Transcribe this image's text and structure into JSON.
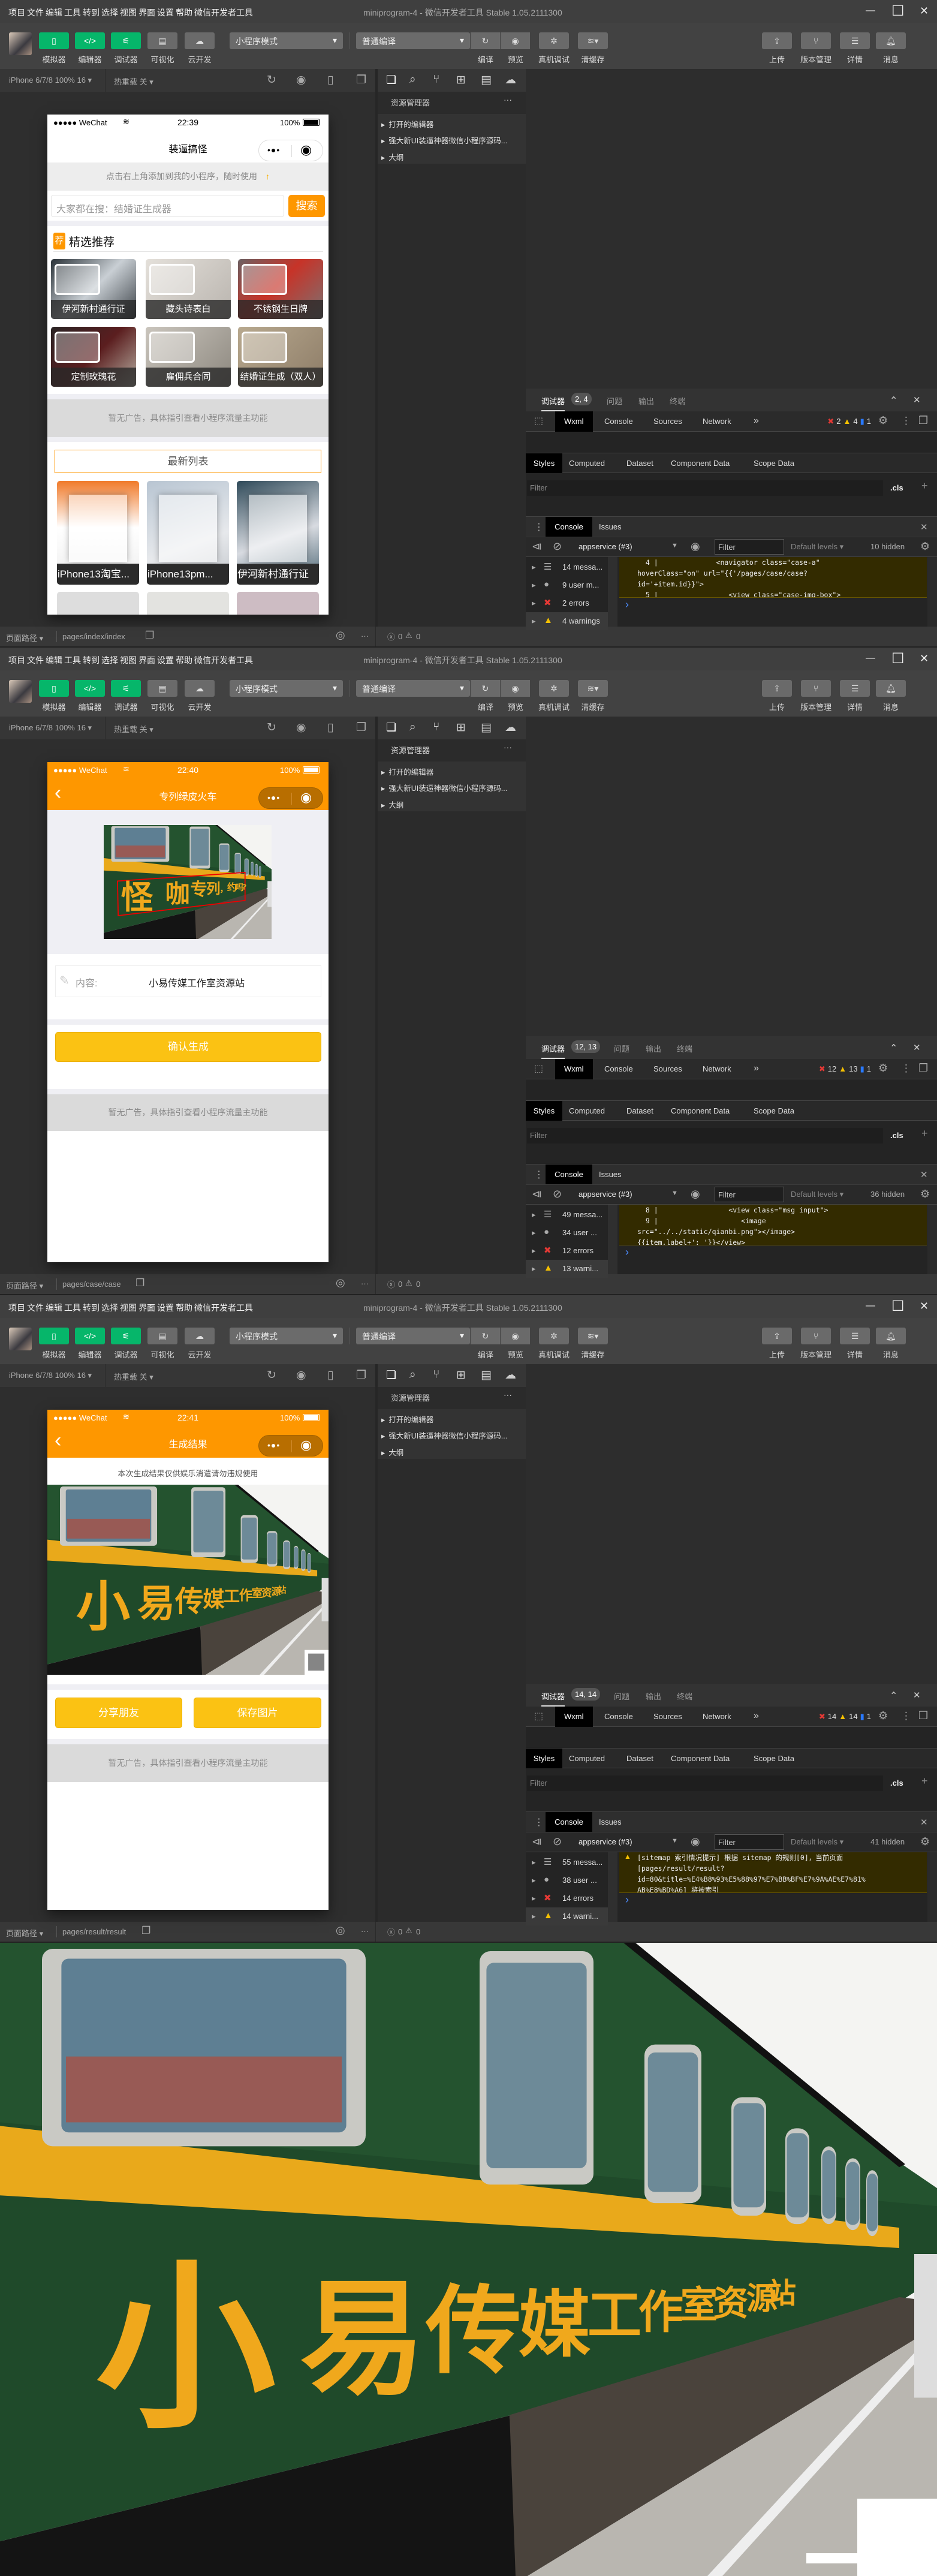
{
  "chrome": {
    "menu": [
      "项目",
      "文件",
      "编辑",
      "工具",
      "转到",
      "选择",
      "视图",
      "界面",
      "设置",
      "帮助",
      "微信开发者工具"
    ],
    "window_title": "miniprogram-4 - 微信开发者工具 Stable 1.05.2111300",
    "left_tools": [
      {
        "label": "模拟器",
        "icon": "phone-icon",
        "glyph": "▯"
      },
      {
        "label": "编辑器",
        "icon": "code-icon",
        "glyph": "</>"
      },
      {
        "label": "调试器",
        "icon": "debug-icon",
        "glyph": "⚟"
      },
      {
        "label": "可视化",
        "icon": "layout-icon",
        "glyph": "▤"
      },
      {
        "label": "云开发",
        "icon": "cloud-icon",
        "glyph": "☁"
      }
    ],
    "mode_select": "小程序模式",
    "compile_select": "普通编译",
    "mid_tools": [
      {
        "label": "编译",
        "icon": "refresh-icon",
        "glyph": "↻"
      },
      {
        "label": "预览",
        "icon": "eye-icon",
        "glyph": "◉"
      },
      {
        "label": "真机调试",
        "icon": "bug-icon",
        "glyph": "✲"
      },
      {
        "label": "清缓存",
        "icon": "layers-icon",
        "glyph": "≋▾"
      }
    ],
    "right_tools": [
      {
        "label": "上传",
        "icon": "upload-icon",
        "glyph": "⇪"
      },
      {
        "label": "版本管理",
        "icon": "branch-icon",
        "glyph": "⑂"
      },
      {
        "label": "详情",
        "icon": "details-icon",
        "glyph": "☰"
      },
      {
        "label": "消息",
        "icon": "bell-icon",
        "glyph": "🔔︎"
      }
    ],
    "device": "iPhone 6/7/8 100% 16 ▾",
    "hot_reload": "热重载 关 ▾",
    "explorer_title": "资源管理器",
    "explorer_more": "···",
    "explorer_items": [
      "打开的编辑器",
      "强大新UI装逼神器微信小程序源码...",
      "大纲"
    ],
    "debugger_tabs": [
      "调试器",
      "问题",
      "输出",
      "终端"
    ],
    "devtools_tabs": [
      "Wxml",
      "Console",
      "Sources",
      "Network"
    ],
    "styles_tabs": [
      "Styles",
      "Computed",
      "Dataset",
      "Component Data",
      "Scope Data"
    ],
    "filter_placeholder": "Filter",
    "cls": ".cls",
    "drawer_tabs": [
      "Console",
      "Issues"
    ],
    "context": "appservice (#3)",
    "levels": "Default levels ▾",
    "footer_label": "页面路径 ▾",
    "footer_errors": "0",
    "footer_warnings": "0",
    "carrier": "●●●●● WeChat",
    "battery": "100%",
    "ad_text": "暂无广告，具体指引查看小程序流量主功能",
    "colors": {
      "accent_green": "#06b66a",
      "orange": "#fe9700",
      "yellow_button": "#fbc213",
      "console_warning_bg": "#332b00"
    }
  },
  "panels": [
    {
      "badge": "2, 4",
      "errors": "2",
      "warnings": "4",
      "infos": "1",
      "hidden": "10 hidden",
      "sidebar": [
        "14 messa...",
        "9 user m...",
        "2 errors",
        "4 warnings"
      ],
      "code": [
        "  4 |              <navigator class=\"case-a\"",
        "hoverClass=\"on\" url=\"{{'/pages/case/case?",
        "id='+item.id}}\">",
        "  5 |                 <view class=\"case-img-box\">"
      ],
      "path": "pages/index/index",
      "phone": {
        "time": "22:39",
        "title": "装逼搞怪",
        "notice": "点击右上角添加到我的小程序，随时使用",
        "search_placeholder": "大家都在搜：结婚证生成器",
        "search_button": "搜索",
        "section_badge": "荐",
        "section_title": "精选推荐",
        "featured": [
          "伊河新村通行证",
          "藏头诗表白",
          "不锈钢生日牌",
          "定制玫瑰花",
          "雇佣兵合同",
          "结婚证生成（双人）"
        ],
        "list_title": "最新列表",
        "latest": [
          "iPhone13淘宝...",
          "iPhone13pm...",
          "伊河新村通行证"
        ]
      }
    },
    {
      "badge": "12, 13",
      "errors": "12",
      "warnings": "13",
      "infos": "1",
      "hidden": "36 hidden",
      "sidebar": [
        "49 messa...",
        "34 user ...",
        "12 errors",
        "13 warni..."
      ],
      "code": [
        "  8 |                 <view class=\"msg input\">",
        "  9 |                    <image",
        "src=\"../../static/qianbi.png\"></image>",
        "{{item.label+': '}}</view>"
      ],
      "path": "pages/case/case",
      "phone": {
        "time": "22:40",
        "title": "专列绿皮火车",
        "image_text": "怪咖专列，约吗?",
        "field_label": "内容:",
        "field_value": "小易传媒工作室资源站",
        "confirm_button": "确认生成"
      }
    },
    {
      "badge": "14, 14",
      "errors": "14",
      "warnings": "14",
      "infos": "1",
      "hidden": "41 hidden",
      "sidebar": [
        "55 messa...",
        "38 user ...",
        "14 errors",
        "14 warni..."
      ],
      "code": [
        "[sitemap 索引情况提示] 根据 sitemap 的规则[0]，当前页面",
        "[pages/result/result?",
        "id=80&title=%E4%B8%93%E5%88%97%E7%BB%BF%E7%9A%AE%E7%81%",
        "AB%E8%BD%A6] 将被索引"
      ],
      "path": "pages/result/result",
      "phone": {
        "time": "22:41",
        "title": "生成结果",
        "disclaimer": "本次生成结果仅供娱乐消遣请勿违规使用",
        "image_text": "小易传媒工作室资源站",
        "share_button": "分享朋友",
        "save_button": "保存图片"
      }
    }
  ],
  "result_image": {
    "text": "小易传媒工作室资源站"
  }
}
